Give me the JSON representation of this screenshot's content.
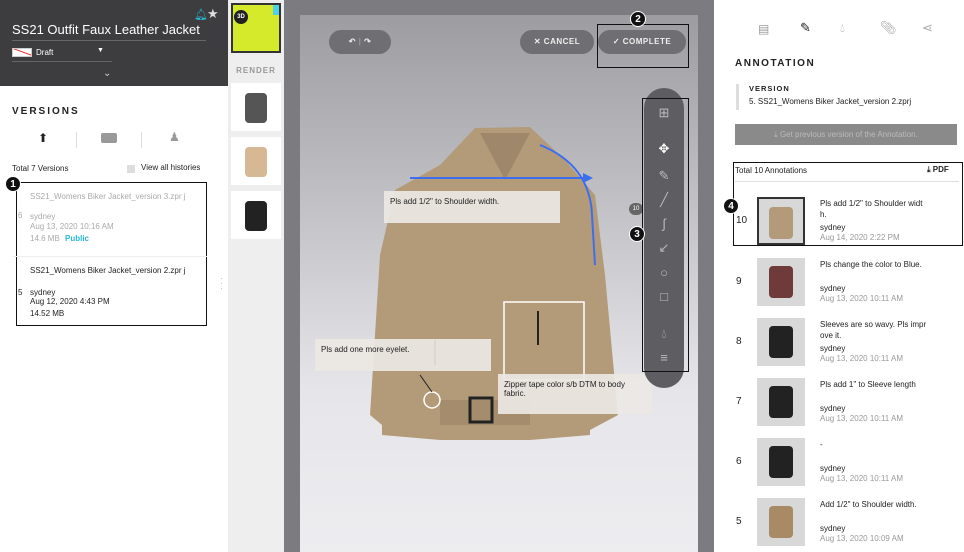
{
  "header": {
    "title": "SS21 Outfit  Faux Leather Jacket",
    "status": "Draft"
  },
  "versions": {
    "heading": "VERSIONS",
    "total": "Total 7 Versions",
    "view_all": "View all histories",
    "items": [
      {
        "num": "6",
        "name": "SS21_Womens Biker Jacket_version 3.zpr j",
        "user": "sydney",
        "date": "Aug 13, 2020 10:16 AM",
        "size": "14.6 MB",
        "tag": "Public"
      },
      {
        "num": "5",
        "name": "SS21_Womens Biker Jacket_version 2.zpr j",
        "user": "sydney",
        "date": "Aug 12, 2020 4:43 PM",
        "size": "14.52 MB",
        "tag": ""
      }
    ]
  },
  "thumbs": {
    "badge_3d": "3D",
    "render_label": "RENDER"
  },
  "canvas": {
    "cancel": "✕ CANCEL",
    "complete": "✓ COMPLETE",
    "notes": [
      "Pls add 1/2\" to Shoulder width.",
      "Pls add one more eyelet.",
      "Zipper tape color s/b DTM to body fabric."
    ],
    "marker": "10"
  },
  "callouts": [
    "1",
    "2",
    "3",
    "4"
  ],
  "annotation": {
    "heading": "ANNOTATION",
    "version_label": "VERSION",
    "version_value": "5. SS21_Womens Biker Jacket_version 2.zprj",
    "get_prev": "Get previous version of the Annotation.",
    "total": "Total 10 Annotations",
    "pdf": "PDF",
    "items": [
      {
        "num": "10",
        "text": "Pls add 1/2\" to Shoulder widt h.",
        "user": "sydney",
        "date": "Aug 14, 2020 2:22 PM",
        "color": "#b39b7a"
      },
      {
        "num": "9",
        "text": "Pls change the color to Blue.",
        "user": "sydney",
        "date": "Aug 13, 2020 10:11 AM",
        "color": "#6e3a3a"
      },
      {
        "num": "8",
        "text": "Sleeves are so wavy. Pls impr ove it.",
        "user": "sydney",
        "date": "Aug 13, 2020 10:11 AM",
        "color": "#222222"
      },
      {
        "num": "7",
        "text": "Pls add 1\" to Sleeve length",
        "user": "sydney",
        "date": "Aug 13, 2020 10:11 AM",
        "color": "#222222"
      },
      {
        "num": "6",
        "text": "-",
        "user": "sydney",
        "date": "Aug 13, 2020 10:11 AM",
        "color": "#222222"
      },
      {
        "num": "5",
        "text": "Add 1/2\" to Shoulder width.",
        "user": "sydney",
        "date": "Aug 13, 2020 10:09 AM",
        "color": "#a88a64"
      }
    ]
  },
  "colors": {
    "accent": "#2ab8d8",
    "jacket": "#b39b7a",
    "arrow": "#3d6ef0"
  }
}
